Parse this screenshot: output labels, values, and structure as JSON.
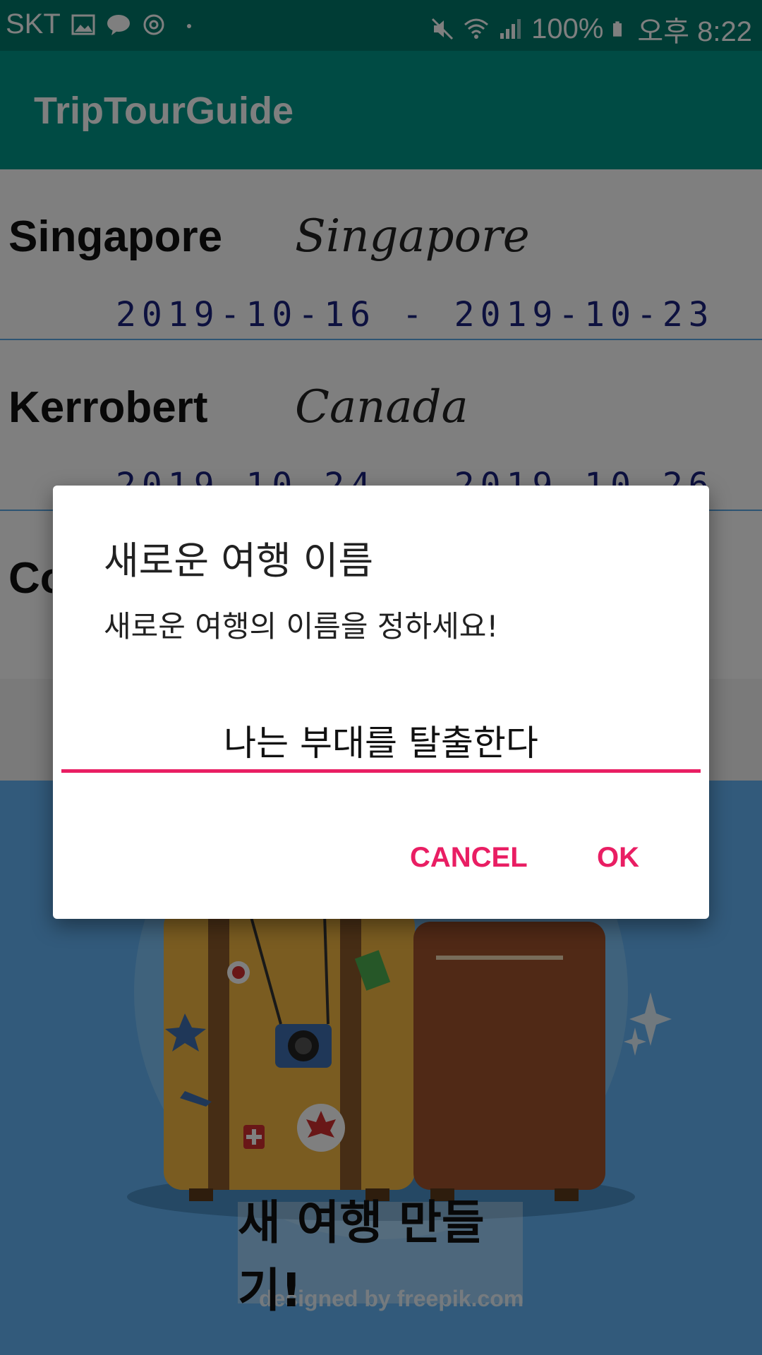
{
  "status_bar": {
    "carrier": "SKT",
    "battery": "100%",
    "time": "오후 8:22",
    "left_icons": [
      "image-icon",
      "talk-icon",
      "sync-icon",
      "dot-icon"
    ],
    "right_icons": [
      "mute-icon",
      "wifi-icon",
      "signal-icon",
      "battery-icon"
    ]
  },
  "app_bar": {
    "title": "TripTourGuide"
  },
  "trips": [
    {
      "city": "Singapore",
      "country": "Singapore",
      "dates": "2019-10-16 - 2019-10-23"
    },
    {
      "city": "Kerrobert",
      "country": "Canada",
      "dates": "2019-10-24 - 2019-10-26"
    },
    {
      "city": "Co",
      "country": "",
      "dates": ""
    }
  ],
  "hero": {
    "create_button_label": "새 여행 만들기!",
    "credit": "designed by freepik.com"
  },
  "dialog": {
    "title": "새로운 여행 이름",
    "message": "새로운 여행의 이름을 정하세요!",
    "input_value": "나는 부대를 탈출한다",
    "cancel_label": "CANCEL",
    "ok_label": "OK"
  },
  "colors": {
    "status_bar": "#00796b",
    "app_bar": "#009688",
    "accent": "#e91e63",
    "hero_bg": "#64b5f6"
  }
}
